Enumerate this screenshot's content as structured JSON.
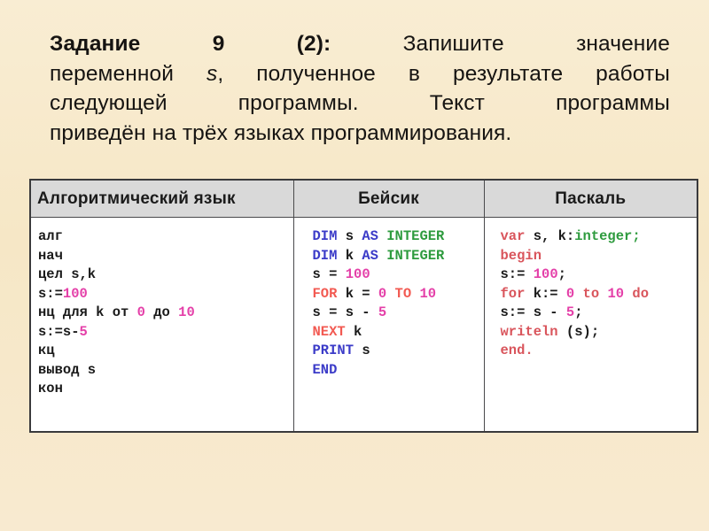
{
  "slide": {
    "background_color": "#f7e9c9"
  },
  "heading": {
    "line1_bold": "Задание",
    "line1_num": "9",
    "line1_sub": "(2):",
    "line1_rest_a": "Запишите",
    "line1_rest_b": "значение",
    "line2_a": "переменной",
    "line2_var": "s",
    "line2_b": ", полученное в результате работы",
    "line3_a": "следующей",
    "line3_b": "программы.",
    "line3_c": "Текст",
    "line3_d": "программы",
    "line4": "приведён на трёх языках программирования."
  },
  "table": {
    "headers": [
      "Алгоритмический язык",
      "Бейсик",
      "Паскаль"
    ],
    "columns": {
      "algorithmic": {
        "language": "Алгоритмический язык",
        "lines": [
          [
            {
              "t": "алг",
              "c": "plain"
            }
          ],
          [
            {
              "t": "нач",
              "c": "plain"
            }
          ],
          [
            {
              "t": "цел s,k",
              "c": "plain"
            }
          ],
          [
            {
              "t": "s:=",
              "c": "plain"
            },
            {
              "t": "100",
              "c": "num"
            }
          ],
          [
            {
              "t": "нц для k от ",
              "c": "plain"
            },
            {
              "t": "0",
              "c": "num"
            },
            {
              "t": " до ",
              "c": "plain"
            },
            {
              "t": "10",
              "c": "num"
            }
          ],
          [
            {
              "t": "s:=s-",
              "c": "plain"
            },
            {
              "t": "5",
              "c": "num"
            }
          ],
          [
            {
              "t": "кц",
              "c": "plain"
            }
          ],
          [
            {
              "t": "вывод s",
              "c": "plain"
            }
          ],
          [
            {
              "t": "кон",
              "c": "plain"
            }
          ]
        ]
      },
      "basic": {
        "language": "Бейсик",
        "lines": [
          [
            {
              "t": "DIM",
              "c": "kw-b"
            },
            {
              "t": " s ",
              "c": "plain"
            },
            {
              "t": "AS",
              "c": "kw-b"
            },
            {
              "t": " ",
              "c": "plain"
            },
            {
              "t": "INTEGER",
              "c": "type"
            }
          ],
          [
            {
              "t": "DIM",
              "c": "kw-b"
            },
            {
              "t": " k ",
              "c": "plain"
            },
            {
              "t": "AS",
              "c": "kw-b"
            },
            {
              "t": " ",
              "c": "plain"
            },
            {
              "t": "INTEGER",
              "c": "type"
            }
          ],
          [
            {
              "t": "s = ",
              "c": "plain"
            },
            {
              "t": "100",
              "c": "num"
            }
          ],
          [
            {
              "t": "FOR",
              "c": "kw-r"
            },
            {
              "t": " k = ",
              "c": "plain"
            },
            {
              "t": "0",
              "c": "num"
            },
            {
              "t": " ",
              "c": "plain"
            },
            {
              "t": "TO",
              "c": "kw-r"
            },
            {
              "t": " ",
              "c": "plain"
            },
            {
              "t": "10",
              "c": "num"
            }
          ],
          [
            {
              "t": "s = s - ",
              "c": "plain"
            },
            {
              "t": "5",
              "c": "num"
            }
          ],
          [
            {
              "t": "NEXT",
              "c": "kw-r"
            },
            {
              "t": " k",
              "c": "plain"
            }
          ],
          [
            {
              "t": "PRINT",
              "c": "kw-b"
            },
            {
              "t": " s",
              "c": "plain"
            }
          ],
          [
            {
              "t": "END",
              "c": "kw-b"
            }
          ]
        ]
      },
      "pascal": {
        "language": "Паскаль",
        "lines": [
          [
            {
              "t": "var",
              "c": "kw-p"
            },
            {
              "t": " s, k:",
              "c": "plain"
            },
            {
              "t": "integer;",
              "c": "type"
            }
          ],
          [
            {
              "t": "begin",
              "c": "kw-p"
            }
          ],
          [
            {
              "t": "s:= ",
              "c": "plain"
            },
            {
              "t": "100",
              "c": "num"
            },
            {
              "t": ";",
              "c": "plain"
            }
          ],
          [
            {
              "t": "for",
              "c": "kw-p"
            },
            {
              "t": " k:= ",
              "c": "plain"
            },
            {
              "t": "0",
              "c": "num"
            },
            {
              "t": " ",
              "c": "plain"
            },
            {
              "t": "to",
              "c": "kw-p"
            },
            {
              "t": " ",
              "c": "plain"
            },
            {
              "t": "10",
              "c": "num"
            },
            {
              "t": " ",
              "c": "plain"
            },
            {
              "t": "do",
              "c": "kw-p"
            }
          ],
          [
            {
              "t": "s:= s - ",
              "c": "plain"
            },
            {
              "t": "5",
              "c": "num"
            },
            {
              "t": ";",
              "c": "plain"
            }
          ],
          [
            {
              "t": "writeln",
              "c": "kw-p"
            },
            {
              "t": " (s);",
              "c": "plain"
            }
          ],
          [
            {
              "t": "end.",
              "c": "kw-p"
            }
          ]
        ]
      }
    }
  },
  "colors": {
    "number": "#e43fa8",
    "basic_keyword_blue": "#3b3bc8",
    "basic_keyword_red": "#f25a52",
    "type_green": "#2e9b3e",
    "pascal_keyword": "#d9555c",
    "header_gray": "#d9d9d9",
    "border": "#3a3a3c",
    "text": "#1a1a1a"
  }
}
